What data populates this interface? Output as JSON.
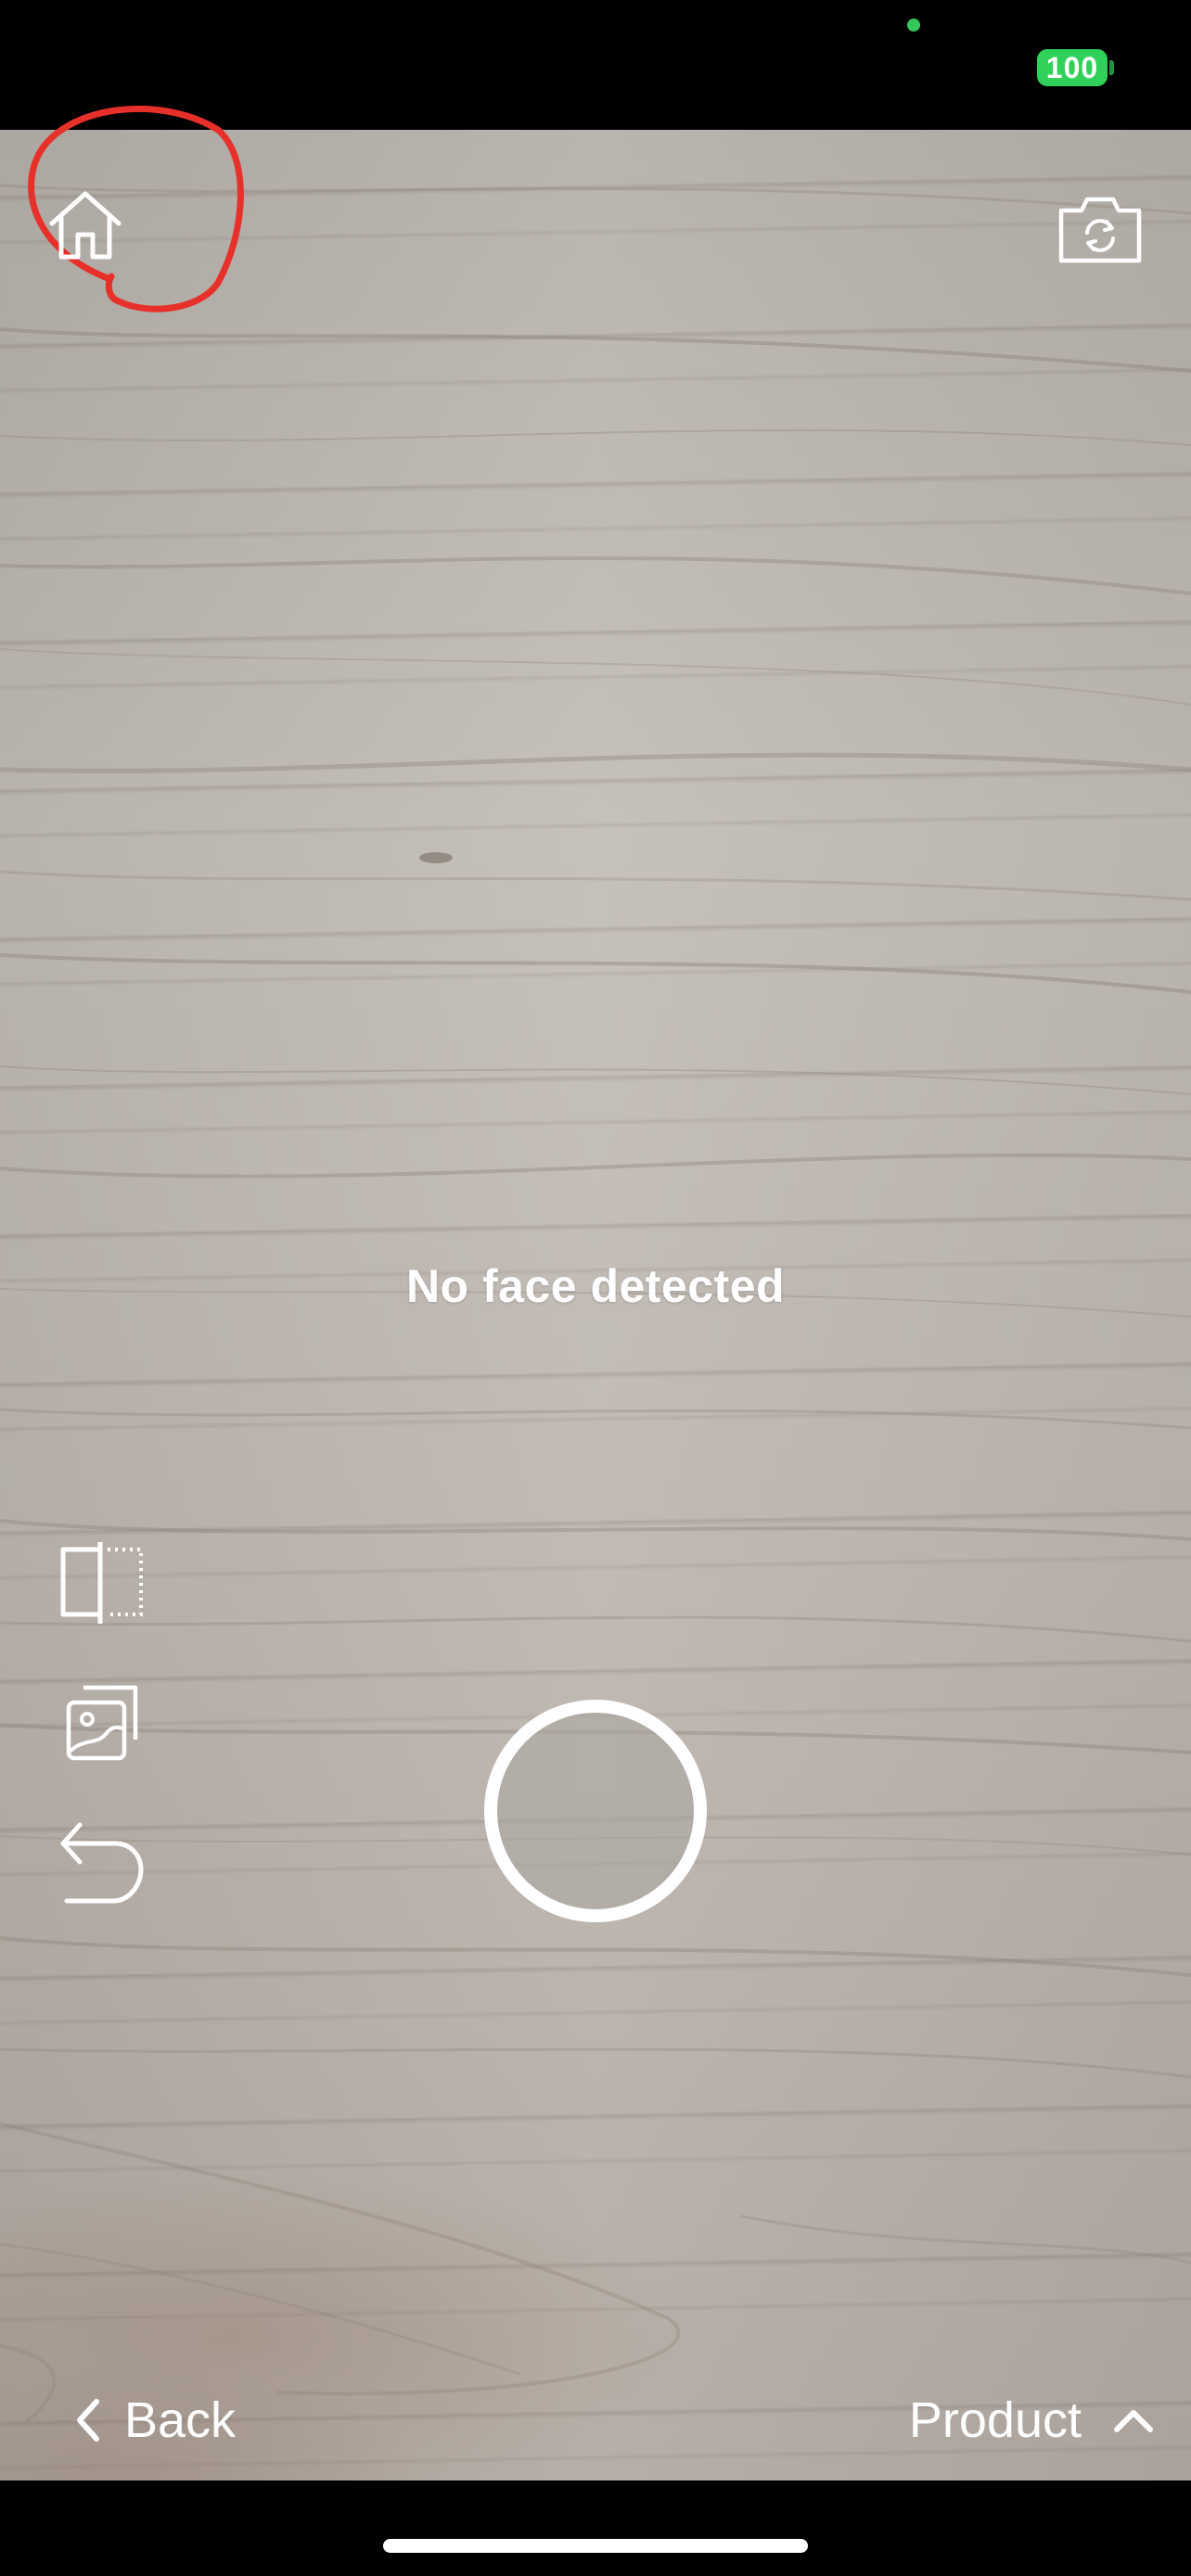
{
  "status_bar": {
    "battery_level": "100",
    "battery_color": "#30d158",
    "camera_indicator_color": "#34c759"
  },
  "top_controls": {
    "home_icon": "home-icon",
    "flip_camera_icon": "camera-flip-icon",
    "annotation_color": "#e8302a"
  },
  "viewfinder": {
    "status_message": "No face detected"
  },
  "side_tools": [
    {
      "icon": "compare-split-icon"
    },
    {
      "icon": "gallery-icon"
    },
    {
      "icon": "undo-icon"
    }
  ],
  "shutter": {
    "icon": "shutter-button"
  },
  "bottom_bar": {
    "back_label": "Back",
    "back_icon": "chevron-left-icon",
    "product_label": "Product",
    "product_icon": "chevron-up-icon"
  }
}
